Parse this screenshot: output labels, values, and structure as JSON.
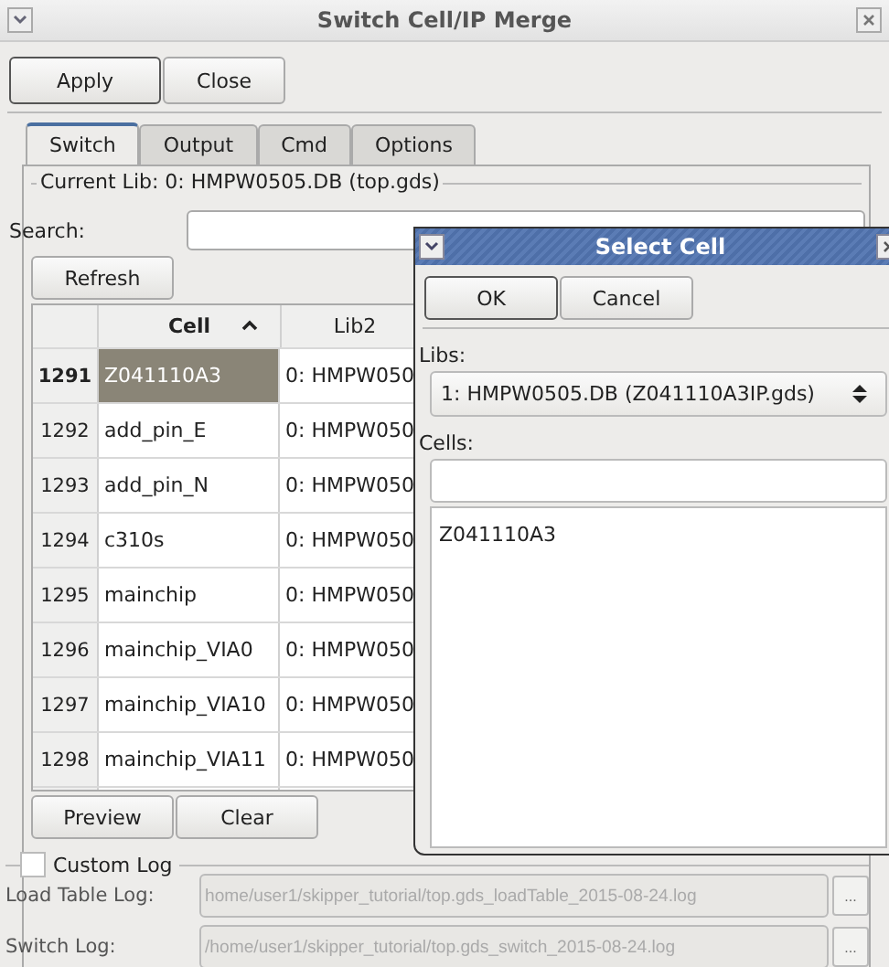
{
  "window": {
    "title": "Switch Cell/IP Merge"
  },
  "buttons": [
    {
      "label": "Apply",
      "default": true
    },
    {
      "label": "Close",
      "default": false
    }
  ],
  "tabs": [
    {
      "label": "Switch",
      "selected": true
    },
    {
      "label": "Output",
      "selected": false
    },
    {
      "label": "Cmd",
      "selected": false
    },
    {
      "label": "Options",
      "selected": false
    }
  ],
  "current_lib": "Current Lib: 0: HMPW0505.DB (top.gds)",
  "search": {
    "label": "Search:"
  },
  "refresh_button": "Refresh",
  "table": {
    "columns": [
      "Cell",
      "Lib2"
    ],
    "rows": [
      {
        "number": "1291",
        "cell": "Z041110A3",
        "lib2": "0: HMPW050",
        "selected": true
      },
      {
        "number": "1292",
        "cell": "add_pin_E",
        "lib2": "0: HMPW050",
        "selected": false
      },
      {
        "number": "1293",
        "cell": "add_pin_N",
        "lib2": "0: HMPW050",
        "selected": false
      },
      {
        "number": "1294",
        "cell": "c310s",
        "lib2": "0: HMPW050",
        "selected": false
      },
      {
        "number": "1295",
        "cell": "mainchip",
        "lib2": "0: HMPW050",
        "selected": false
      },
      {
        "number": "1296",
        "cell": "mainchip_VIA0",
        "lib2": "0: HMPW050",
        "selected": false
      },
      {
        "number": "1297",
        "cell": "mainchip_VIA10",
        "lib2": "0: HMPW050",
        "selected": false
      },
      {
        "number": "1298",
        "cell": "mainchip_VIA11",
        "lib2": "0: HMPW050",
        "selected": false
      }
    ]
  },
  "bottom_buttons": [
    "Preview",
    "Clear"
  ],
  "custom_log": {
    "label": "Custom Log",
    "checked": false
  },
  "logs": [
    {
      "label": "Load Table Log:",
      "value": "home/user1/skipper_tutorial/top.gds_loadTable_2015-08-24.log",
      "disabled": true,
      "browse": "..."
    },
    {
      "label": "Switch Log:",
      "value": "/home/user1/skipper_tutorial/top.gds_switch_2015-08-24.log",
      "disabled": true,
      "browse": "..."
    }
  ],
  "dialog": {
    "title": "Select Cell",
    "buttons": [
      {
        "label": "OK",
        "default": true
      },
      {
        "label": "Cancel",
        "default": false
      }
    ],
    "libs_label": "Libs:",
    "libs_value": "1: HMPW0505.DB (Z041110A3IP.gds)",
    "cells_label": "Cells:",
    "cells": [
      "Z041110A3"
    ]
  }
}
